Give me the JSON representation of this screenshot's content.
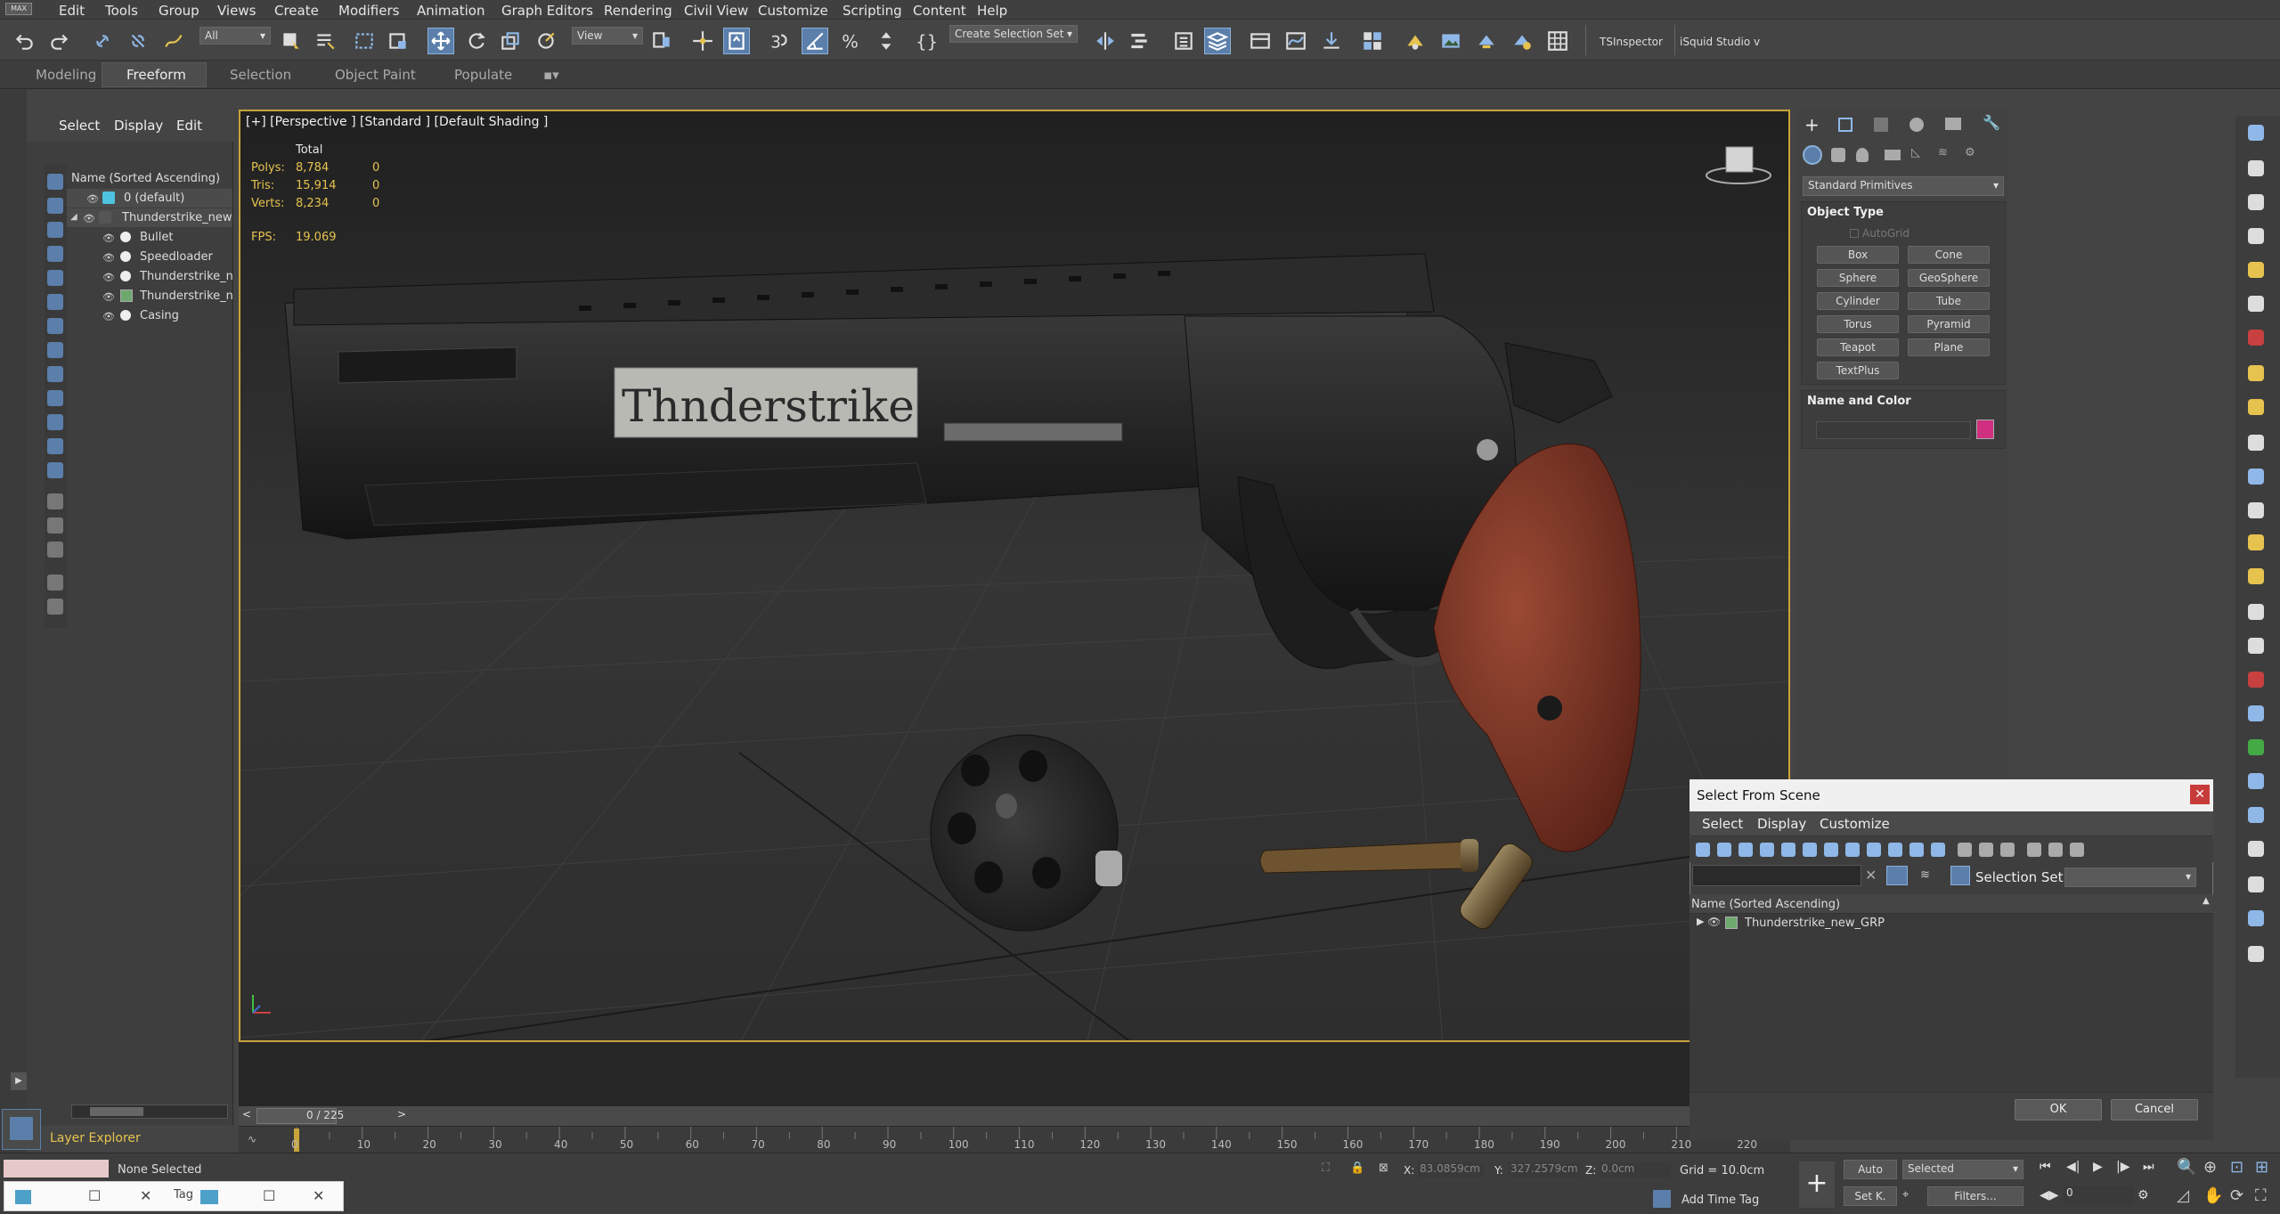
{
  "menubar": {
    "logo": "MAX",
    "items": [
      "Edit",
      "Tools",
      "Group",
      "Views",
      "Create",
      "Modifiers",
      "Animation",
      "Graph Editors",
      "Rendering",
      "Civil View",
      "Customize",
      "Scripting",
      "Content",
      "Help"
    ]
  },
  "toolbar": {
    "filter_value": "All",
    "refcoord_value": "View",
    "selection_set_value": "Create Selection Set",
    "ts_inspector": "TSInspector",
    "isquid": "iSquid Studio v"
  },
  "ribbon": {
    "tabs": [
      "Modeling",
      "Freeform",
      "Selection",
      "Object Paint",
      "Populate"
    ],
    "active_tab": "Freeform"
  },
  "scene_explorer": {
    "menu": [
      "Select",
      "Display",
      "Edit"
    ],
    "header": "Name (Sorted Ascending)",
    "rows": [
      {
        "name": "0 (default)"
      },
      {
        "name": "Thunderstrike_new"
      },
      {
        "name": "Bullet"
      },
      {
        "name": "Speedloader"
      },
      {
        "name": "Thunderstrike_new"
      },
      {
        "name": "Thunderstrike_new"
      },
      {
        "name": "Casing"
      }
    ],
    "layer_explorer": "Layer Explorer"
  },
  "viewport": {
    "label": "[+] [Perspective ] [Standard ] [Default Shading ]",
    "stats_header": "Total",
    "stats": [
      {
        "label": "Polys:",
        "total": "8,784",
        "sel": "0"
      },
      {
        "label": "Tris:",
        "total": "15,914",
        "sel": "0"
      },
      {
        "label": "Verts:",
        "total": "8,234",
        "sel": "0"
      }
    ],
    "fps_label": "FPS:",
    "fps_value": "19.069",
    "barrel_text": "Thnderstrike"
  },
  "timeline": {
    "frame": "0 / 225",
    "ticks": [
      "0",
      "10",
      "20",
      "30",
      "40",
      "50",
      "60",
      "70",
      "80",
      "90",
      "100",
      "110",
      "120",
      "130",
      "140",
      "150",
      "160",
      "170",
      "180",
      "190",
      "200",
      "210",
      "220"
    ]
  },
  "command_panel": {
    "category": "Standard Primitives",
    "object_type_title": "Object Type",
    "autogrid": "AutoGrid",
    "buttons": [
      "Box",
      "Cone",
      "Sphere",
      "GeoSphere",
      "Cylinder",
      "Tube",
      "Torus",
      "Pyramid",
      "Teapot",
      "Plane",
      "TextPlus"
    ],
    "name_color_title": "Name and Color",
    "swatch_color": "#d0307f"
  },
  "dialog": {
    "title": "Select From Scene",
    "menu": [
      "Select",
      "Display",
      "Customize"
    ],
    "selection_set_label": "Selection Set:",
    "list_header": "Name (Sorted Ascending)",
    "items": [
      "Thunderstrike_new_GRP"
    ],
    "ok": "OK",
    "cancel": "Cancel"
  },
  "status": {
    "none_selected": "None Selected",
    "x_label": "X:",
    "x_value": "83.0859cm",
    "y_label": "Y:",
    "y_value": "327.2579cm",
    "z_label": "Z:",
    "z_value": "0.0cm",
    "grid": "Grid = 10.0cm",
    "add_time_tag": "Add Time Tag",
    "auto": "Auto",
    "selected": "Selected",
    "set_k": "Set K.",
    "filters": "Filters...",
    "frame_value": "0",
    "tag_text": "Tag"
  },
  "colors": {
    "accent": "#5b7faa",
    "viewport_border": "#c8a43a",
    "stats_text": "#e6c34f",
    "grip": "#8a3424"
  }
}
